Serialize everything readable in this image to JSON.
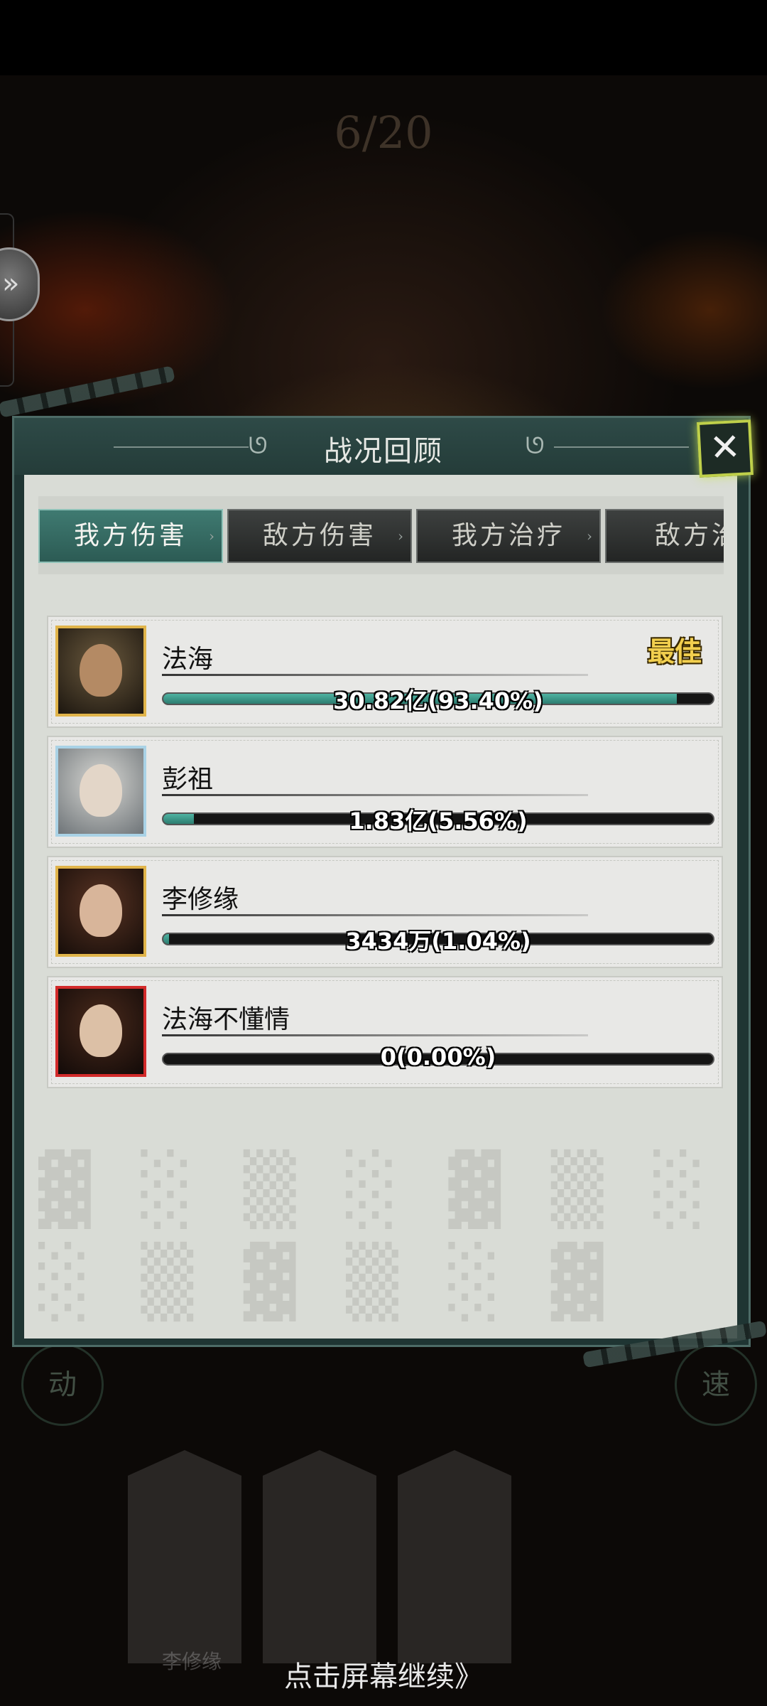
{
  "battle": {
    "round_counter": "6/20"
  },
  "panel": {
    "title": "战况回顾",
    "close_glyph": "✕"
  },
  "tabs": [
    {
      "label": "我方伤害",
      "active": true
    },
    {
      "label": "敌方伤害",
      "active": false
    },
    {
      "label": "我方治疗",
      "active": false
    },
    {
      "label": "敌方治",
      "active": false
    }
  ],
  "rows": [
    {
      "name": "法海",
      "value_text": "30.82亿(93.40%)",
      "percent": 93.4,
      "badge": "最佳",
      "avatar_icon": "monk-avatar-icon",
      "frame": "gold"
    },
    {
      "name": "彭祖",
      "value_text": "1.83亿(5.56%)",
      "percent": 5.56,
      "badge": "",
      "avatar_icon": "elder-avatar-icon",
      "frame": "blue"
    },
    {
      "name": "李修缘",
      "value_text": "3434万(1.04%)",
      "percent": 1.04,
      "badge": "",
      "avatar_icon": "warrior-avatar-icon",
      "frame": "gold"
    },
    {
      "name": "法海不懂情",
      "value_text": "0(0.00%)",
      "percent": 0.0,
      "badge": "",
      "avatar_icon": "swordsman-avatar-icon",
      "frame": "red"
    }
  ],
  "background": {
    "ghost_label": "李修缘"
  },
  "footer": {
    "continue_hint": "点击屏幕继续》"
  },
  "colors": {
    "accent_teal": "#3f7a71",
    "bar_fill": "#4fb3a2",
    "best_badge": "#f2cf4e",
    "frame_gold": "#e0b44a",
    "frame_blue": "#a9d2e6",
    "frame_red": "#d22a2a"
  }
}
